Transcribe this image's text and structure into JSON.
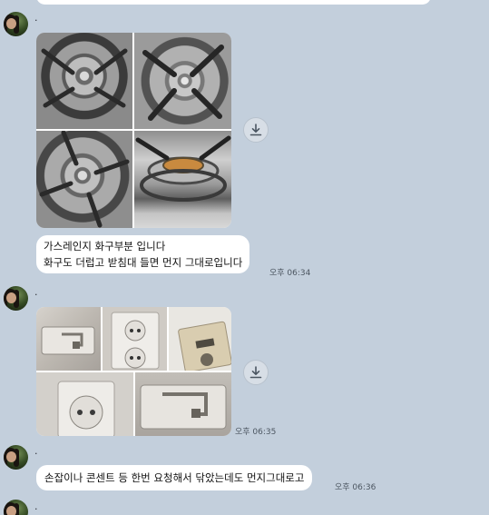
{
  "chat": {
    "messages": [
      {
        "sender": ".",
        "type": "image_grid",
        "images": [
          "stove-burner-cap-photo",
          "stove-grate-closeup-photo",
          "stove-burner-ring-photo",
          "stove-burner-side-photo"
        ]
      },
      {
        "type": "text",
        "lines": [
          "가스레인지 화구부분 입니다",
          "화구도 더럽고 받침대 들면 먼지 그대로입니다"
        ],
        "time": "오후 06:34"
      },
      {
        "sender": ".",
        "type": "image_grid",
        "images": [
          "door-handle-photo",
          "wall-outlet-photo",
          "thermostat-panel-photo",
          "wall-outlet-closeup-photo",
          "door-handle-closeup-photo"
        ],
        "time": "오후 06:35"
      },
      {
        "sender": ".",
        "type": "text",
        "lines": [
          "손잡이나 콘센트 등 한번 요청해서 닦았는데도 먼지그대로고"
        ],
        "time": "오후 06:36"
      },
      {
        "sender": "."
      }
    ]
  },
  "icons": {
    "download": "download-icon"
  },
  "colors": {
    "background": "#c3cfdc",
    "bubble": "#ffffff",
    "time_text": "#4c5661"
  }
}
